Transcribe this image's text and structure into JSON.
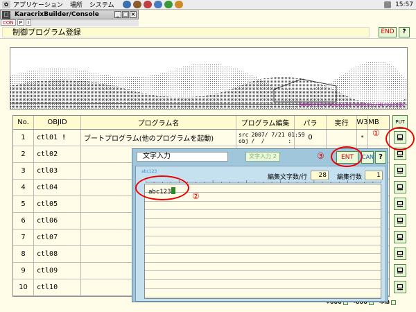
{
  "panel": {
    "menu": [
      "アプリケーション",
      "場所",
      "システム"
    ],
    "clock": "15:57"
  },
  "window": {
    "title": "KaracrixBuilder/Console",
    "mini_tabs": [
      "CON",
      "P",
      "I",
      "",
      "",
      ""
    ]
  },
  "header": {
    "title": "制御プログラム登録",
    "end_label": "END",
    "help_label": "?"
  },
  "banner": {
    "credit": "KanbaraYorunouyuki(syohan)/Hiroshige"
  },
  "table": {
    "columns": [
      "No.",
      "OBJID",
      "プログラム名",
      "プログラム編集",
      "パラ",
      "実行",
      "W3",
      "MB"
    ],
    "rows": [
      {
        "no": "1",
        "id": "ctl01",
        "flag": "!",
        "name": "ブートプログラム(他のプログラムを起動)",
        "edit_kind": "src\nobj",
        "edit_date": "2007/ 7/21 01:59",
        "edit_date2": "/  /       :",
        "para": "0",
        "run": "",
        "w3": "*",
        "mb": ""
      },
      {
        "no": "2",
        "id": "ctl02",
        "flag": "",
        "name": "",
        "edit_kind": "",
        "edit_date": "",
        "edit_date2": "",
        "para": "",
        "run": "",
        "w3": "",
        "mb": ""
      },
      {
        "no": "3",
        "id": "ctl03",
        "flag": "",
        "name": "",
        "edit_kind": "",
        "edit_date": "",
        "edit_date2": "",
        "para": "",
        "run": "",
        "w3": "",
        "mb": ""
      },
      {
        "no": "4",
        "id": "ctl04",
        "flag": "",
        "name": "",
        "edit_kind": "",
        "edit_date": "",
        "edit_date2": "",
        "para": "",
        "run": "",
        "w3": "",
        "mb": ""
      },
      {
        "no": "5",
        "id": "ctl05",
        "flag": "",
        "name": "",
        "edit_kind": "",
        "edit_date": "",
        "edit_date2": "",
        "para": "",
        "run": "",
        "w3": "",
        "mb": ""
      },
      {
        "no": "6",
        "id": "ctl06",
        "flag": "",
        "name": "",
        "edit_kind": "",
        "edit_date": "",
        "edit_date2": "",
        "para": "",
        "run": "",
        "w3": "",
        "mb": ""
      },
      {
        "no": "7",
        "id": "ctl07",
        "flag": "",
        "name": "",
        "edit_kind": "",
        "edit_date": "",
        "edit_date2": "",
        "para": "",
        "run": "",
        "w3": "",
        "mb": ""
      },
      {
        "no": "8",
        "id": "ctl08",
        "flag": "",
        "name": "",
        "edit_kind": "",
        "edit_date": "",
        "edit_date2": "",
        "para": "",
        "run": "",
        "w3": "",
        "mb": ""
      },
      {
        "no": "9",
        "id": "ctl09",
        "flag": "",
        "name": "",
        "edit_kind": "",
        "edit_date": "",
        "edit_date2": "",
        "para": "",
        "run": "",
        "w3": "",
        "mb": ""
      },
      {
        "no": "10",
        "id": "ctl10",
        "flag": "",
        "name": "",
        "edit_kind": "",
        "edit_date": "",
        "edit_date2": "",
        "para": "",
        "run": "",
        "w3": "",
        "mb": ""
      }
    ],
    "put_label": "PUT"
  },
  "bottom": {
    "labels": [
      "+UUU",
      "-UUU",
      "-MB"
    ]
  },
  "dialog": {
    "title": "文字入力",
    "tab2_label": "文字入力 2",
    "ent_label": "ENT",
    "can_label": "CAN",
    "help_label": "?",
    "hint": "abc123",
    "chars_per_line_label": "編集文字数/行",
    "chars_per_line": "28",
    "lines_label": "編集行数",
    "lines": "1",
    "text": "abc123"
  },
  "annotations": {
    "one": "①",
    "two": "②",
    "three": "③"
  },
  "colors": {
    "accent_red": "#dd0000",
    "button_green": "#eaf8d8",
    "dialog_blue": "#9fc6da"
  }
}
